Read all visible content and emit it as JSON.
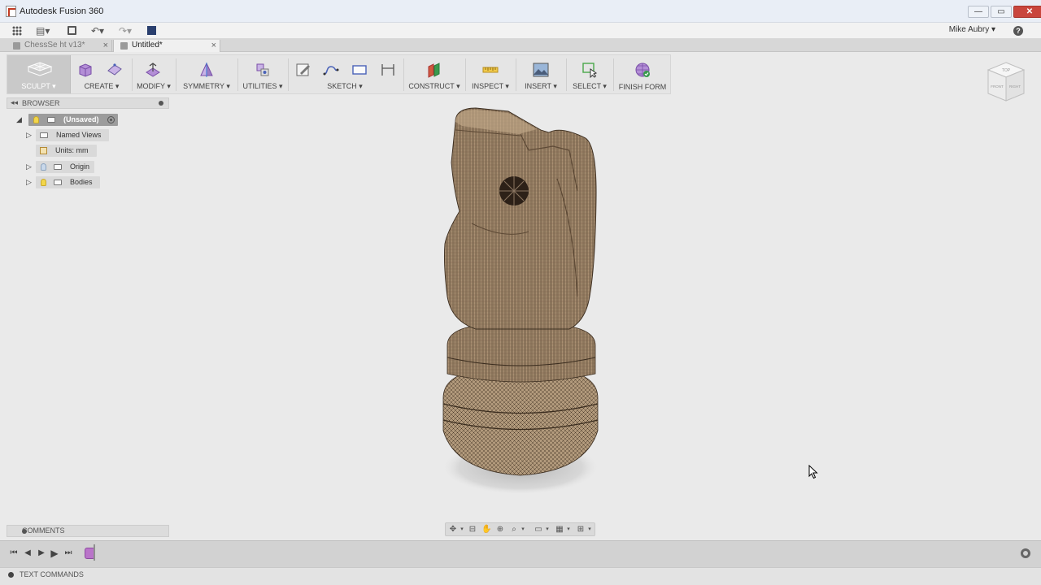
{
  "window": {
    "title": "Autodesk Fusion 360"
  },
  "quick_access": {
    "user_name": "Mike Aubry ▾",
    "help_label": "?"
  },
  "tabs": [
    {
      "label": "ChessSe   ht v13*",
      "active": false
    },
    {
      "label": "Untitled*",
      "active": true
    }
  ],
  "toolbar": {
    "workspace": "SCULPT ▾",
    "groups": {
      "create": "CREATE ▾",
      "modify": "MODIFY ▾",
      "symmetry": "SYMMETRY ▾",
      "utilities": "UTILITIES ▾",
      "sketch": "SKETCH ▾",
      "construct": "CONSTRUCT ▾",
      "inspect": "INSPECT ▾",
      "insert": "INSERT ▾",
      "select": "SELECT ▾",
      "finish_form": "FINISH FORM"
    }
  },
  "browser": {
    "title": "BROWSER",
    "root": "(Unsaved)",
    "items": [
      {
        "label": "Named Views"
      },
      {
        "label": "Units: mm"
      },
      {
        "label": "Origin"
      },
      {
        "label": "Bodies"
      }
    ]
  },
  "comments": {
    "title": "COMMENTS"
  },
  "viewcube": {
    "top": "TOP",
    "front": "FRONT",
    "right": "RIGHT"
  },
  "text_commands": {
    "label": "TEXT COMMANDS"
  },
  "icons": [
    "app-grid-icon",
    "file-icon",
    "save-icon",
    "undo-icon",
    "redo-icon",
    "stop-icon",
    "help-icon",
    "gear-icon"
  ]
}
